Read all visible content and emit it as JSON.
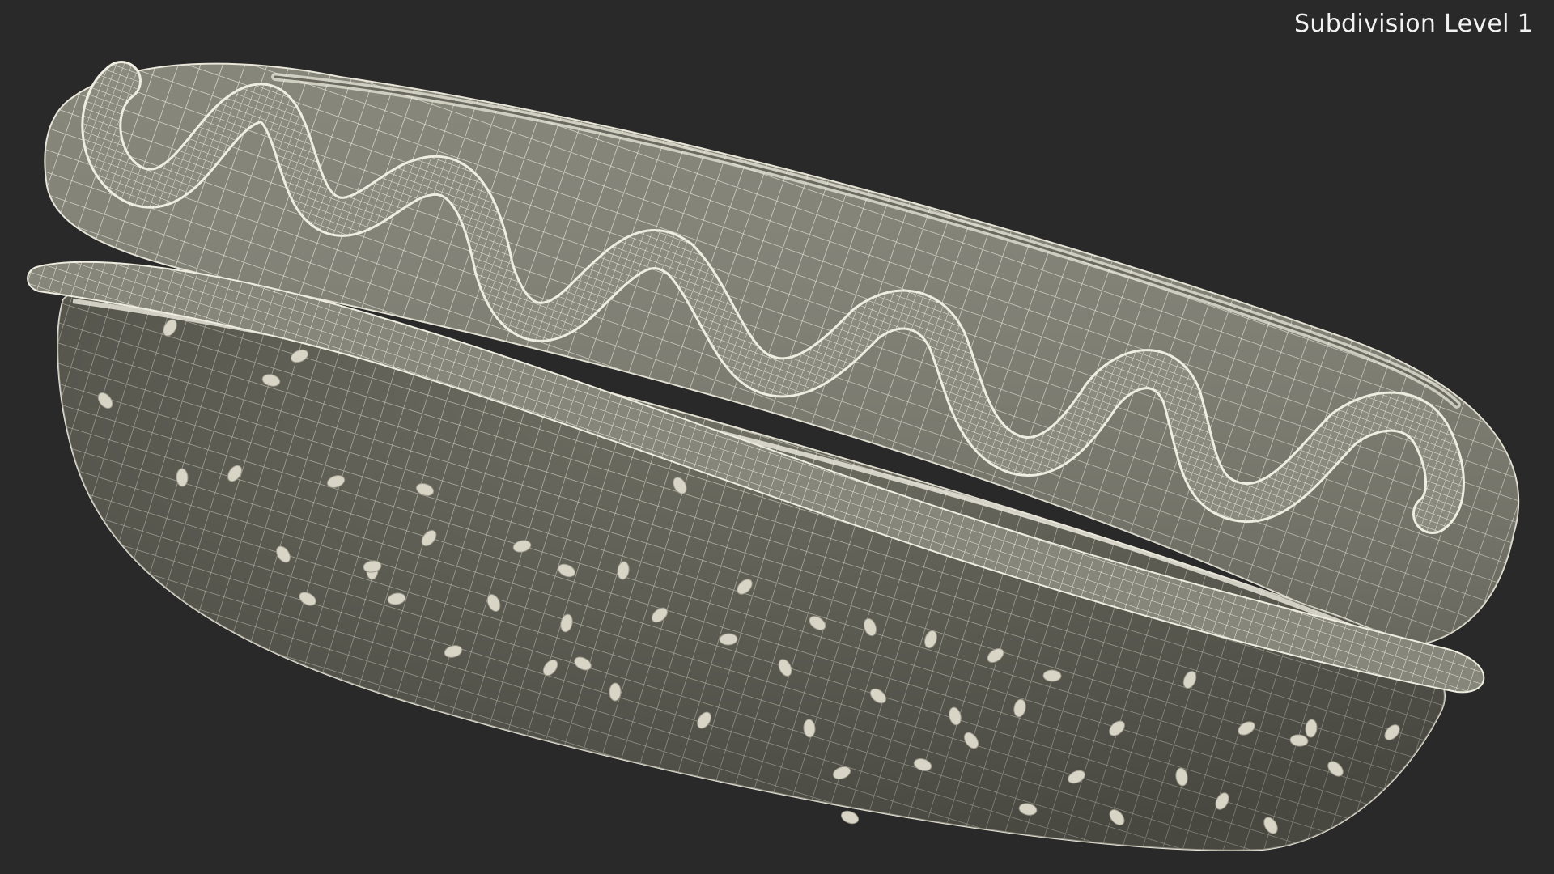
{
  "viewport": {
    "label": "Subdivision Level 1"
  },
  "colors": {
    "background": "#292929",
    "surface": "#7f7f73",
    "surface_dark": "#5e5e55",
    "wire": "#ebe8da",
    "seed": "#d8d5c6"
  },
  "model": {
    "parts": [
      "bun-top-half",
      "bun-bottom-half",
      "sausage",
      "mustard-squiggle",
      "sesame-seeds"
    ]
  }
}
